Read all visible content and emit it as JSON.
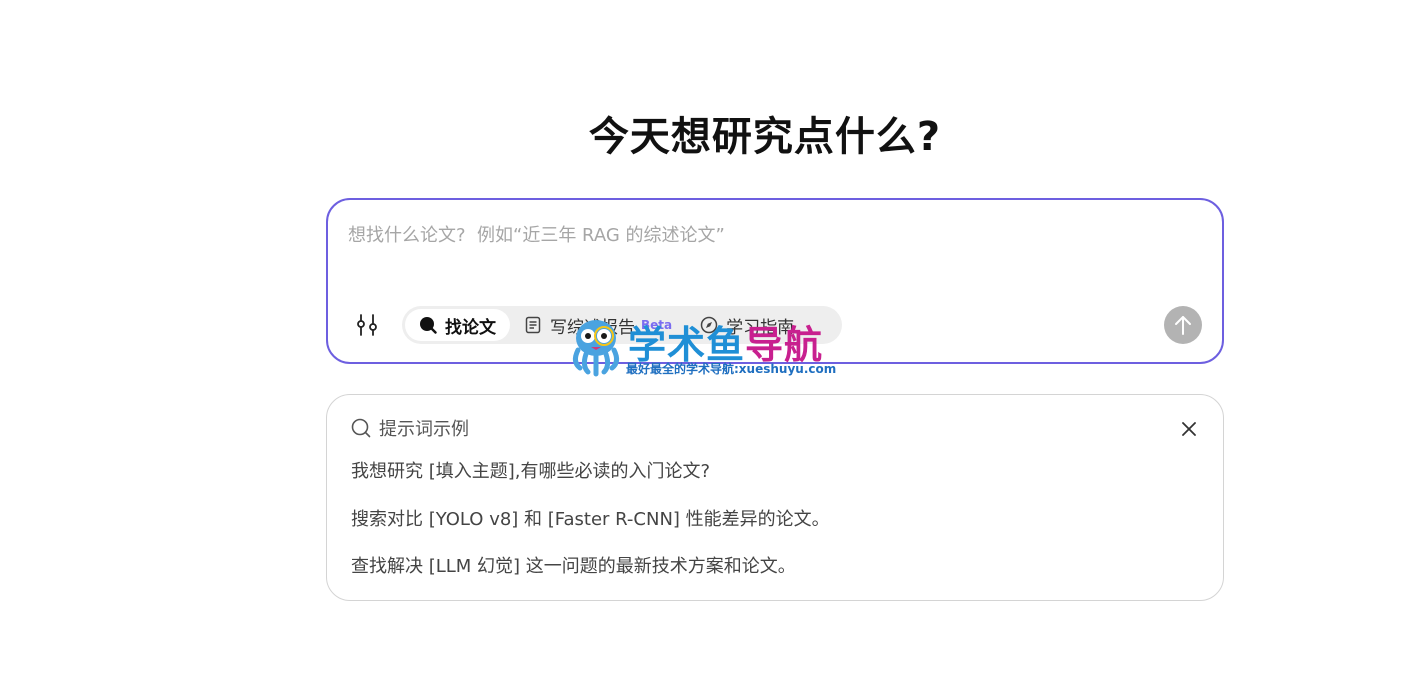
{
  "heading": "今天想研究点什么?",
  "composer": {
    "placeholder": "想找什么论文?  例如“近三年 RAG 的综述论文”",
    "modes": [
      {
        "label": "找论文",
        "icon": "search-filled-icon",
        "active": true
      },
      {
        "label": "写综述报告",
        "icon": "document-icon",
        "badge": "Beta",
        "active": false
      },
      {
        "label": "学习指南",
        "icon": "compass-icon",
        "active": false
      }
    ],
    "filter_icon": "sliders-icon",
    "send_icon": "arrow-up-icon"
  },
  "watermark": {
    "title_part1": "学术鱼",
    "title_part2": "导航",
    "subtitle": "最好最全的学术导航:xueshuyu.com"
  },
  "prompts": {
    "title": "提示词示例",
    "items": [
      "我想研究 [填入主题],有哪些必读的入门论文?",
      "搜索对比 [YOLO v8] 和 [Faster R-CNN] 性能差异的论文。",
      "查找解决 [LLM 幻觉] 这一问题的最新技术方案和论文。"
    ]
  },
  "colors": {
    "accent_border": "#6d5fe0",
    "send_button": "#b3b3b3",
    "beta": "#7b6cf0"
  }
}
